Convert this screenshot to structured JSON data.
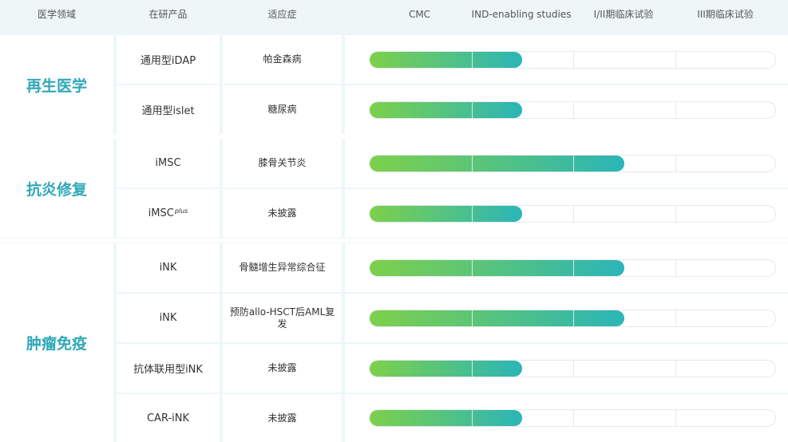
{
  "header": {
    "area": "医学领域",
    "product": "在研产品",
    "indication": "适应症",
    "stage1": "CMC",
    "stage2": "IND-enabling studies",
    "stage3": "I/II期临床试验",
    "stage4": "III期临床试验"
  },
  "groups": [
    {
      "name": "再生医学",
      "rows": [
        {
          "product": "通用型iDAP",
          "indication": "帕金森病",
          "progress_stages": 1.5
        },
        {
          "product": "通用型islet",
          "indication": "糖尿病",
          "progress_stages": 1.5
        }
      ]
    },
    {
      "name": "抗炎修复",
      "rows": [
        {
          "product": "iMSC",
          "indication": "膝骨关节炎",
          "progress_stages": 2.5
        },
        {
          "product": "iMSC",
          "product_sup": "plus",
          "indication": "未披露",
          "progress_stages": 1.5
        }
      ]
    },
    {
      "name": "肿瘤免疫",
      "rows": [
        {
          "product": "iNK",
          "indication": "骨髓增生异常综合征",
          "progress_stages": 2.5
        },
        {
          "product": "iNK",
          "indication": "预防allo-HSCT后AML复发",
          "progress_stages": 2.5
        },
        {
          "product": "抗体联用型iNK",
          "indication": "未披露",
          "progress_stages": 1.5
        },
        {
          "product": "CAR-iNK",
          "indication": "未披露",
          "progress_stages": 1.5
        }
      ]
    }
  ],
  "colors": {
    "accent": "#2fa8b8",
    "header_bg": "#eef6f8",
    "bar_start": "#7dd04a",
    "bar_end": "#2bb5b8"
  }
}
